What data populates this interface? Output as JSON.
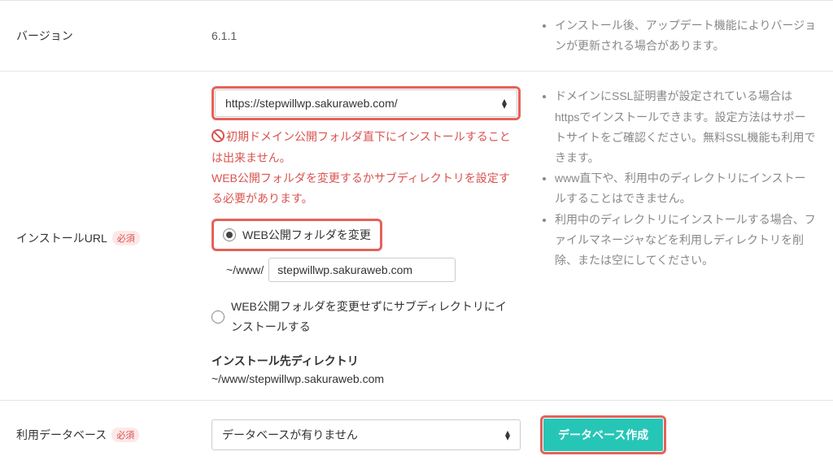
{
  "version": {
    "label": "バージョン",
    "value": "6.1.1",
    "note": "インストール後、アップデート機能によりバージョンが更新される場合があります。"
  },
  "install_url": {
    "label": "インストールURL",
    "required_text": "必須",
    "domain_select": "https://stepwillwp.sakuraweb.com/",
    "error_line1": "初期ドメイン公開フォルダ直下にインストールすることは出来ません。",
    "error_line2": "WEB公開フォルダを変更するかサブディレクトリを設定する必要があります。",
    "radio1_label": "WEB公開フォルダを変更",
    "path_prefix": "~/www/",
    "path_value": "stepwillwp.sakuraweb.com",
    "radio2_label": "WEB公開フォルダを変更せずにサブディレクトリにインストールする",
    "dest_label": "インストール先ディレクトリ",
    "dest_value": "~/www/stepwillwp.sakuraweb.com",
    "notes": [
      "ドメインにSSL証明書が設定されている場合はhttpsでインストールできます。設定方法はサポートサイトをご確認ください。無料SSL機能も利用できます。",
      "www直下や、利用中のディレクトリにインストールすることはできません。",
      "利用中のディレクトリにインストールする場合、ファイルマネージャなどを利用しディレクトリを削除、または空にしてください。"
    ]
  },
  "database": {
    "label": "利用データベース",
    "required_text": "必須",
    "select_text": "データベースが有りません",
    "create_button": "データベース作成"
  }
}
